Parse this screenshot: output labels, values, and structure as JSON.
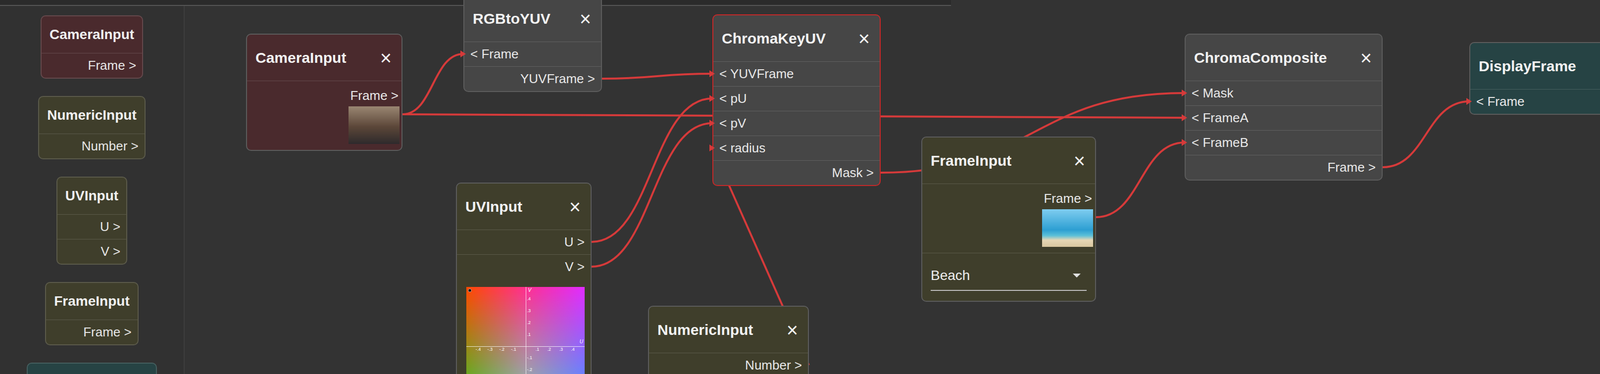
{
  "palette": [
    {
      "title": "CameraInput",
      "kind": "camera",
      "outputs": [
        "Frame >"
      ],
      "color": "#4a2a2d"
    },
    {
      "title": "NumericInput",
      "kind": "numeric",
      "outputs": [
        "Number >"
      ],
      "color": "#3f3e2b"
    },
    {
      "title": "UVInput",
      "kind": "uv",
      "outputs": [
        "U >",
        "V >"
      ],
      "color": "#3f3e2b"
    },
    {
      "title": "FrameInput",
      "kind": "frame",
      "outputs": [
        "Frame >"
      ],
      "color": "#3f3e2b"
    },
    {
      "kind": "display",
      "outputs": [],
      "color": "#264344"
    }
  ],
  "nodes": [
    {
      "title": "CameraInput",
      "close": "×",
      "kind": "camera",
      "color": "#4a2a2d",
      "selected": false,
      "inputs": [],
      "outputs": [
        "Frame >"
      ]
    },
    {
      "title": "RGBtoYUV",
      "close": "×",
      "kind": "process",
      "color": "#464646",
      "selected": false,
      "inputs": [
        "< Frame"
      ],
      "outputs": [
        "YUVFrame >"
      ]
    },
    {
      "title": "ChromaKeyUV",
      "close": "×",
      "kind": "process",
      "color": "#464646",
      "selected": true,
      "inputs": [
        "< YUVFrame",
        "< pU",
        "< pV",
        "< radius"
      ],
      "outputs": [
        "Mask >"
      ]
    },
    {
      "title": "UVInput",
      "close": "×",
      "kind": "uv",
      "color": "#3f3e2b",
      "selected": false,
      "inputs": [],
      "outputs": [
        "U >",
        "V >"
      ],
      "plane": {
        "u_label": "U",
        "v_label": "V",
        "u_ticks": [
          "-.4",
          "-.3",
          "-.2",
          "-.1",
          ".1",
          ".2",
          ".3",
          ".4"
        ],
        "v_ticks": [
          ".4",
          ".3",
          ".2",
          ".1",
          "-.1",
          "-.2"
        ],
        "marker": {
          "u": -0.47,
          "v": 0.47
        }
      }
    },
    {
      "title": "NumericInput",
      "close": "×",
      "kind": "numeric",
      "color": "#3f3e2b",
      "selected": false,
      "inputs": [],
      "outputs": [
        "Number >"
      ]
    },
    {
      "title": "FrameInput",
      "close": "×",
      "kind": "frame",
      "color": "#3f3e2b",
      "selected": false,
      "inputs": [],
      "outputs": [
        "Frame >"
      ],
      "dropdown": "Beach"
    },
    {
      "title": "ChromaComposite",
      "close": "×",
      "kind": "process",
      "color": "#464646",
      "selected": false,
      "inputs": [
        "< Mask",
        "< FrameA",
        "< FrameB"
      ],
      "outputs": [
        "Frame >"
      ]
    },
    {
      "title": "DisplayFrame",
      "kind": "display",
      "color": "#264344",
      "selected": false,
      "inputs": [
        "< Frame"
      ],
      "outputs": []
    }
  ],
  "wires": [
    {
      "from": [
        0,
        0
      ],
      "to": [
        1,
        0
      ]
    },
    {
      "from": [
        0,
        0
      ],
      "to": [
        6,
        1
      ]
    },
    {
      "from": [
        1,
        0
      ],
      "to": [
        2,
        0
      ]
    },
    {
      "from": [
        3,
        0
      ],
      "to": [
        2,
        1
      ]
    },
    {
      "from": [
        3,
        1
      ],
      "to": [
        2,
        2
      ]
    },
    {
      "from": [
        4,
        0
      ],
      "to": [
        2,
        3
      ]
    },
    {
      "from": [
        2,
        0
      ],
      "to": [
        6,
        0
      ]
    },
    {
      "from": [
        5,
        0
      ],
      "to": [
        6,
        2
      ]
    },
    {
      "from": [
        6,
        0
      ],
      "to": [
        7,
        0
      ]
    }
  ]
}
